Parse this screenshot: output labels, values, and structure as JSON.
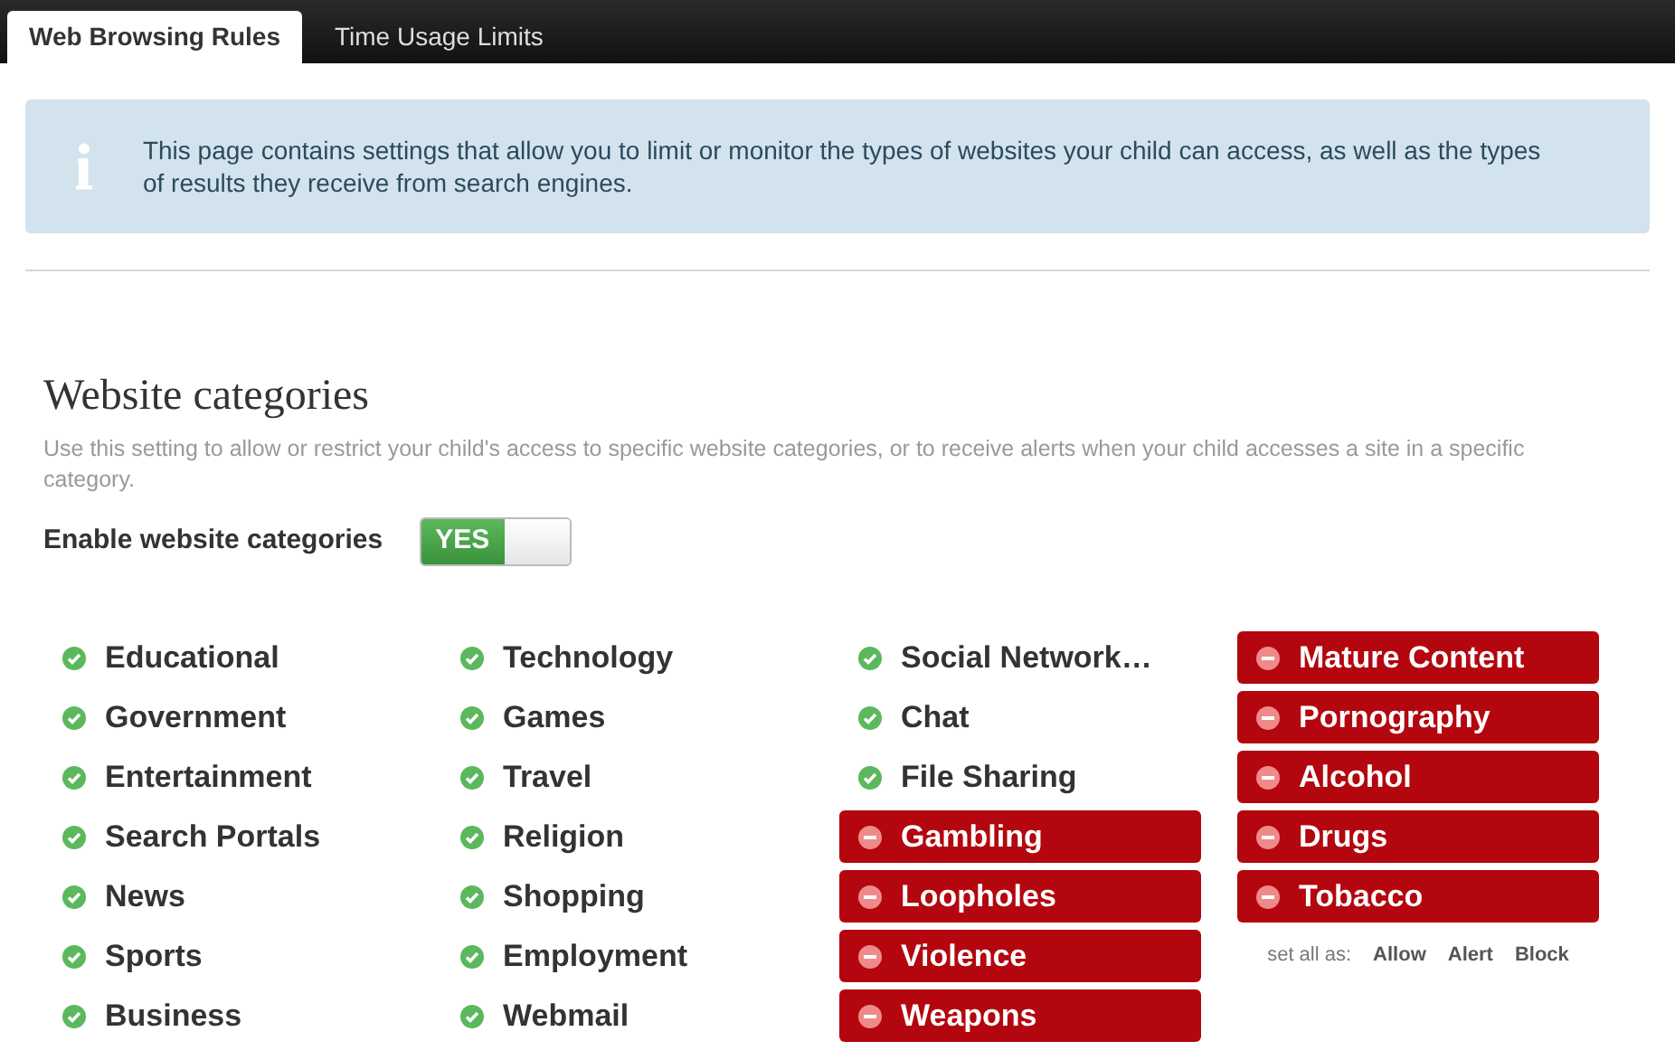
{
  "tabs": [
    {
      "label": "Web Browsing Rules",
      "selected": true
    },
    {
      "label": "Time Usage Limits",
      "selected": false
    }
  ],
  "info": "This page contains settings that allow you to limit or monitor the types of websites your child can access, as well as the types of results they receive from search engines.",
  "section": {
    "title": "Website categories",
    "description": "Use this setting to allow or restrict your child's access to specific website categories, or to receive alerts when your child accesses a site in a specific category.",
    "enable": {
      "label": "Enable website categories",
      "on": true,
      "text": "YES"
    }
  },
  "columns": [
    [
      {
        "label": "Educational",
        "blocked": false
      },
      {
        "label": "Government",
        "blocked": false
      },
      {
        "label": "Entertainment",
        "blocked": false
      },
      {
        "label": "Search Portals",
        "blocked": false
      },
      {
        "label": "News",
        "blocked": false
      },
      {
        "label": "Sports",
        "blocked": false
      },
      {
        "label": "Business",
        "blocked": false
      }
    ],
    [
      {
        "label": "Technology",
        "blocked": false
      },
      {
        "label": "Games",
        "blocked": false
      },
      {
        "label": "Travel",
        "blocked": false
      },
      {
        "label": "Religion",
        "blocked": false
      },
      {
        "label": "Shopping",
        "blocked": false
      },
      {
        "label": "Employment",
        "blocked": false
      },
      {
        "label": "Webmail",
        "blocked": false
      }
    ],
    [
      {
        "label": "Social Network…",
        "blocked": false
      },
      {
        "label": "Chat",
        "blocked": false
      },
      {
        "label": "File Sharing",
        "blocked": false
      },
      {
        "label": "Gambling",
        "blocked": true
      },
      {
        "label": "Loopholes",
        "blocked": true
      },
      {
        "label": "Violence",
        "blocked": true
      },
      {
        "label": "Weapons",
        "blocked": true
      }
    ],
    [
      {
        "label": "Mature Content",
        "blocked": true
      },
      {
        "label": "Pornography",
        "blocked": true
      },
      {
        "label": "Alcohol",
        "blocked": true
      },
      {
        "label": "Drugs",
        "blocked": true
      },
      {
        "label": "Tobacco",
        "blocked": true
      }
    ]
  ],
  "set_all": {
    "label": "set all as:",
    "options": [
      "Allow",
      "Alert",
      "Block"
    ]
  }
}
